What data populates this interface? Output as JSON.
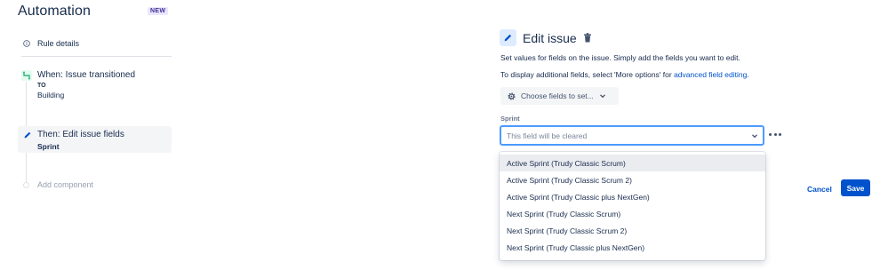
{
  "app": {
    "title": "Automation",
    "badge": "NEW"
  },
  "sidebar": {
    "rule_details": "Rule details",
    "trigger": {
      "title": "When: Issue transitioned",
      "sub1": "TO",
      "sub2": "Building"
    },
    "action": {
      "title": "Then: Edit issue fields",
      "sub": "Sprint"
    },
    "add_component": "Add component"
  },
  "editor": {
    "title": "Edit issue",
    "description": "Set values for fields on the issue. Simply add the fields you want to edit.",
    "more_info_prefix": "To display additional fields, select 'More options' for ",
    "more_info_link": "advanced field editing",
    "more_info_suffix": ".",
    "choose_fields": "Choose fields to set...",
    "sprint_label": "Sprint",
    "sprint_placeholder": "This field will be cleared",
    "dropdown_options": [
      "Active Sprint (Trudy Classic Scrum)",
      "Active Sprint (Trudy Classic Scrum 2)",
      "Active Sprint (Trudy Classic plus NextGen)",
      "Next Sprint (Trudy Classic Scrum)",
      "Next Sprint (Trudy Classic Scrum 2)",
      "Next Sprint (Trudy Classic plus NextGen)"
    ],
    "cancel": "Cancel",
    "save": "Save"
  },
  "colors": {
    "accent": "#0052cc",
    "focus_border": "#4c9aff",
    "badge_bg": "#eae6ff",
    "trigger_green": "#36b37e"
  },
  "icons": [
    "info-icon",
    "branch-icon",
    "pencil-icon",
    "trash-icon",
    "gear-icon",
    "chevron-down-icon",
    "more-icon"
  ]
}
